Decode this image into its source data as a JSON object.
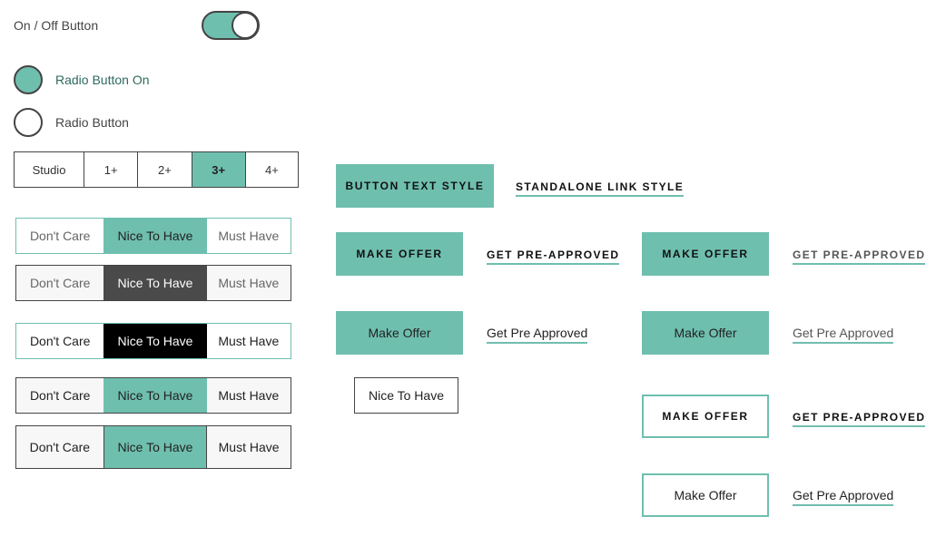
{
  "toggle": {
    "label": "On / Off Button",
    "state": "on"
  },
  "radios": [
    {
      "label": "Radio Button On",
      "checked": true
    },
    {
      "label": "Radio Button",
      "checked": false
    }
  ],
  "beds": {
    "options": [
      "Studio",
      "1+",
      "2+",
      "3+",
      "4+"
    ],
    "selected": "3+"
  },
  "preference_sets": [
    {
      "options": [
        "Don't Care",
        "Nice To Have",
        "Must Have"
      ],
      "selected": "Nice To Have"
    },
    {
      "options": [
        "Don't Care",
        "Nice To Have",
        "Must Have"
      ],
      "selected": "Nice To Have"
    },
    {
      "options": [
        "Don't Care",
        "Nice To Have",
        "Must Have"
      ],
      "selected": "Nice To Have"
    },
    {
      "options": [
        "Don't Care",
        "Nice To Have",
        "Must Have"
      ],
      "selected": "Nice To Have"
    },
    {
      "options": [
        "Don't Care",
        "Nice To Have",
        "Must Have"
      ],
      "selected": "Nice To Have"
    }
  ],
  "buttons": {
    "text_style": "BUTTON TEXT STYLE",
    "make_offer_caps": "MAKE OFFER",
    "make_offer": "Make Offer",
    "nice_to_have": "Nice To Have"
  },
  "links": {
    "standalone": "STANDALONE LINK STYLE",
    "pre_approved_caps": "GET PRE-APPROVED",
    "pre_approved": "Get Pre Approved"
  },
  "colors": {
    "accent": "#6fbfaf",
    "dark": "#4a4a4a",
    "black": "#000000",
    "border": "#444444"
  }
}
